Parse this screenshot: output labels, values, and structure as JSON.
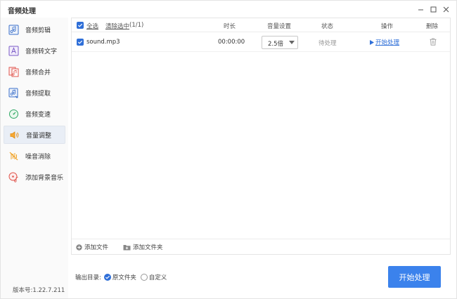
{
  "window": {
    "title": "音频处理",
    "controls": {
      "minimize": "−",
      "maximize": "□",
      "close": "✕"
    }
  },
  "sidebar": {
    "items": [
      {
        "label": "音频剪辑",
        "icon": "audio-cut-icon",
        "active": false
      },
      {
        "label": "音频转文字",
        "icon": "audio-to-text-icon",
        "active": false
      },
      {
        "label": "音频合并",
        "icon": "audio-merge-icon",
        "active": false
      },
      {
        "label": "音频提取",
        "icon": "audio-extract-icon",
        "active": false
      },
      {
        "label": "音频变速",
        "icon": "audio-speed-icon",
        "active": false
      },
      {
        "label": "音量调整",
        "icon": "volume-icon",
        "active": true
      },
      {
        "label": "噪音消除",
        "icon": "noise-removal-icon",
        "active": false
      },
      {
        "label": "添加背景音乐",
        "icon": "background-music-icon",
        "active": false
      }
    ],
    "version": "版本号:1.22.7.211"
  },
  "table": {
    "select_all": "全选",
    "clear_selection": "清除选中",
    "selection_count": "(1/1)",
    "columns": {
      "duration": "时长",
      "volume": "音量设置",
      "status": "状态",
      "action": "操作",
      "delete": "删除"
    },
    "rows": [
      {
        "checked": true,
        "filename": "sound.mp3",
        "duration": "00:00:00",
        "volume": "2.5倍",
        "status": "待处理",
        "action": "开始处理"
      }
    ]
  },
  "footer": {
    "add_file": "添加文件",
    "add_folder": "添加文件夹"
  },
  "output": {
    "label": "输出目录:",
    "options": [
      {
        "label": "原文件夹",
        "selected": true
      },
      {
        "label": "自定义",
        "selected": false
      }
    ]
  },
  "primary_button": "开始处理",
  "colors": {
    "accent": "#3b82ec",
    "link": "#2f6fd8",
    "active_nav_bg": "#e9eef6"
  }
}
